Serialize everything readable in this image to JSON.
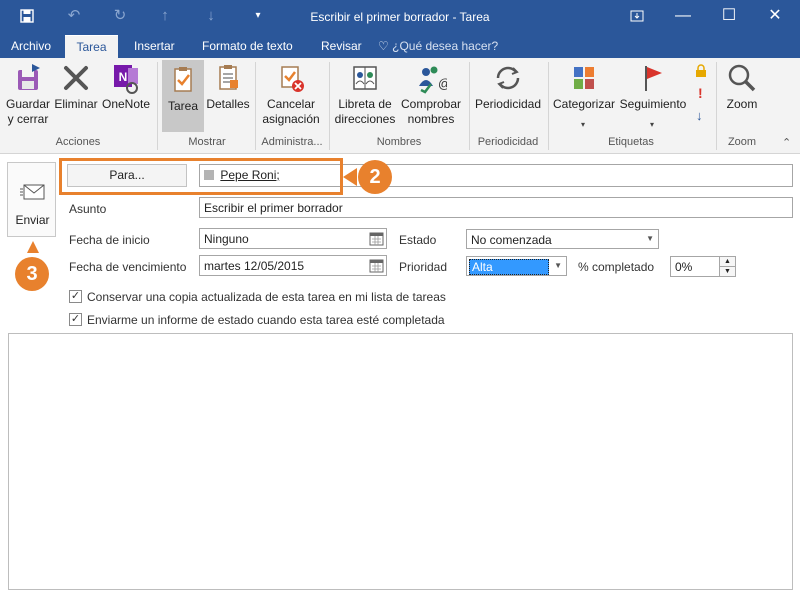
{
  "window": {
    "title": "Escribir el primer borrador - Tarea"
  },
  "quick_access": [
    "save-icon",
    "undo-icon",
    "redo-icon",
    "up-icon",
    "down-icon",
    "customize-icon"
  ],
  "window_controls": [
    "restore-ribbon-icon",
    "minimize-icon",
    "maximize-icon",
    "close-icon"
  ],
  "tabs": {
    "archivo": "Archivo",
    "tarea": "Tarea",
    "insertar": "Insertar",
    "formato": "Formato de texto",
    "revisar": "Revisar",
    "tellme": "¿Qué desea hacer?"
  },
  "ribbon": {
    "acciones": {
      "group": "Acciones",
      "guardar_1": "Guardar",
      "guardar_2": "y cerrar",
      "eliminar": "Eliminar",
      "onenote": "OneNote"
    },
    "mostrar": {
      "group": "Mostrar",
      "tarea": "Tarea",
      "detalles": "Detalles"
    },
    "administrar": {
      "group": "Administra...",
      "cancelar_1": "Cancelar",
      "cancelar_2": "asignación"
    },
    "nombres": {
      "group": "Nombres",
      "libreta_1": "Libreta de",
      "libreta_2": "direcciones",
      "comprobar_1": "Comprobar",
      "comprobar_2": "nombres"
    },
    "periodicidad": {
      "group": "Periodicidad",
      "btn": "Periodicidad"
    },
    "etiquetas": {
      "group": "Etiquetas",
      "categorizar": "Categorizar",
      "seguimiento": "Seguimiento"
    },
    "zoom": {
      "group": "Zoom",
      "btn": "Zoom"
    }
  },
  "form": {
    "send": "Enviar",
    "para_button": "Para...",
    "para_value": "Pepe Roni;",
    "asunto_label": "Asunto",
    "asunto_value": "Escribir el primer borrador",
    "fecha_inicio_label": "Fecha de inicio",
    "fecha_inicio_value": "Ninguno",
    "fecha_venc_label": "Fecha de vencimiento",
    "fecha_venc_value": "martes 12/05/2015",
    "estado_label": "Estado",
    "estado_value": "No comenzada",
    "prioridad_label": "Prioridad",
    "prioridad_value": "Alta",
    "completado_label": "% completado",
    "completado_value": "0%",
    "check1": "Conservar una copia actualizada de esta tarea en mi lista de tareas",
    "check2": "Enviarme un informe de estado cuando esta tarea esté completada"
  },
  "markers": {
    "m2": "2",
    "m3": "3"
  },
  "colors": {
    "accent": "#2b579a",
    "highlight": "#e8812d"
  }
}
